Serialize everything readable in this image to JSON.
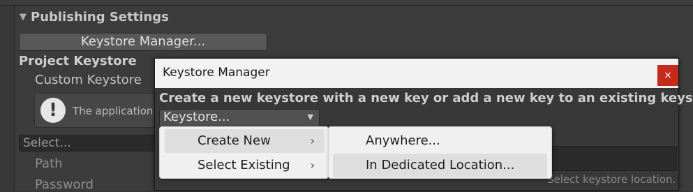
{
  "inspector": {
    "section_title": "Publishing Settings",
    "keystore_manager_button": "Keystore Manager...",
    "project_keystore_label": "Project Keystore",
    "custom_keystore_label": "Custom Keystore",
    "help_text": "The application w",
    "select_placeholder": "Select...",
    "path_label": "Path",
    "password_label": "Password"
  },
  "dialog": {
    "title": "Keystore Manager",
    "close_glyph": "×",
    "heading": "Create a new keystore with a new key or add a new key to an existing keystore",
    "dropdown_value": "Keystore...",
    "hint": "Select keystore location."
  },
  "menu": {
    "items": [
      {
        "label": "Create New",
        "submenu": true,
        "highlighted": true
      },
      {
        "label": "Select Existing",
        "submenu": true,
        "highlighted": false
      }
    ],
    "submenu_items": [
      {
        "label": "Anywhere...",
        "highlighted": false
      },
      {
        "label": "In Dedicated Location...",
        "highlighted": true
      }
    ],
    "chevron_glyph": "›"
  },
  "icons": {
    "section_toggle": "triangle-down-icon",
    "help": "exclamation-icon",
    "dropdown": "triangle-down-icon",
    "submenu": "chevron-right-icon",
    "close": "close-icon"
  },
  "colors": {
    "close_button": "#c42b1c",
    "menu_background": "#f0f0f0",
    "menu_highlight": "#dedede",
    "editor_background": "#383838"
  }
}
